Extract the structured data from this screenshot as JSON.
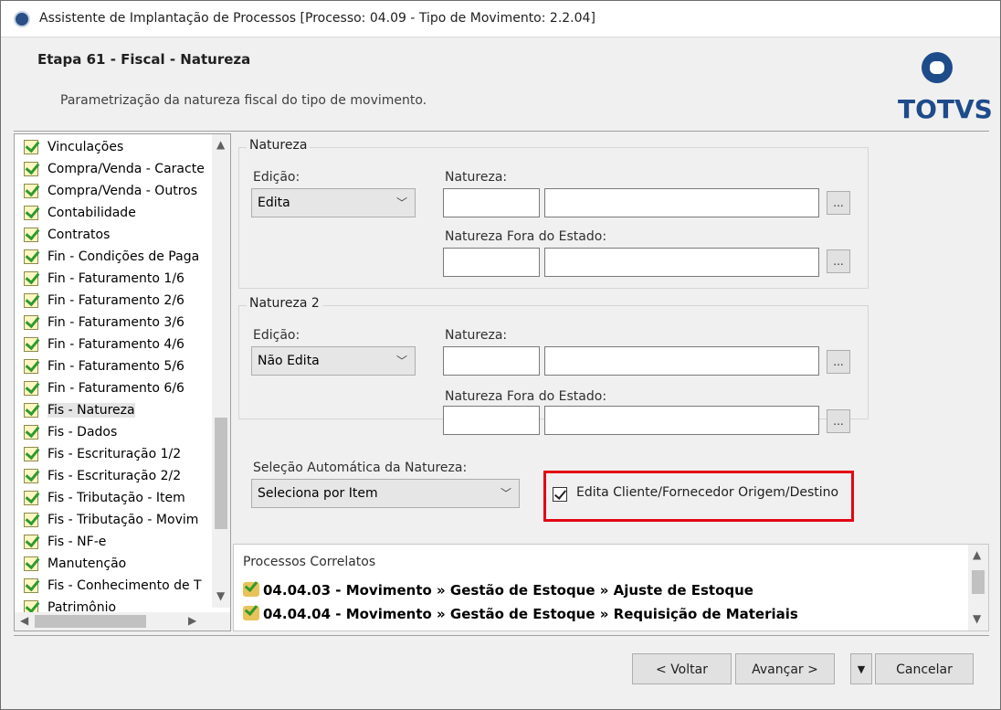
{
  "window": {
    "title": "Assistente de Implantação de Processos [Processo: 04.09 - Tipo de Movimento: 2.2.04]"
  },
  "header": {
    "step_title": "Etapa 61 - Fiscal - Natureza",
    "description": "Parametrização da natureza fiscal do tipo de movimento.",
    "logo_text": "TOTVS"
  },
  "tree": {
    "items": [
      {
        "label": "Vinculações"
      },
      {
        "label": "Compra/Venda - Caracte"
      },
      {
        "label": "Compra/Venda - Outros"
      },
      {
        "label": "Contabilidade"
      },
      {
        "label": "Contratos"
      },
      {
        "label": "Fin - Condições de Paga"
      },
      {
        "label": "Fin - Faturamento 1/6"
      },
      {
        "label": "Fin - Faturamento 2/6"
      },
      {
        "label": "Fin - Faturamento 3/6"
      },
      {
        "label": "Fin - Faturamento 4/6"
      },
      {
        "label": "Fin - Faturamento 5/6"
      },
      {
        "label": "Fin - Faturamento 6/6"
      },
      {
        "label": "Fis - Natureza",
        "selected": true
      },
      {
        "label": "Fis - Dados"
      },
      {
        "label": "Fis - Escrituração 1/2"
      },
      {
        "label": "Fis - Escrituração 2/2"
      },
      {
        "label": "Fis - Tributação - Item"
      },
      {
        "label": "Fis - Tributação - Movim"
      },
      {
        "label": "Fis - NF-e"
      },
      {
        "label": "Manutenção"
      },
      {
        "label": "Fis - Conhecimento de T"
      },
      {
        "label": "Patrimônio"
      }
    ]
  },
  "natureza": {
    "legend": "Natureza",
    "edicao_label": "Edição:",
    "edicao_value": "Edita",
    "natureza_label": "Natureza:",
    "fora_label": "Natureza Fora do Estado:",
    "dots": "..."
  },
  "natureza2": {
    "legend": "Natureza 2",
    "edicao_label": "Edição:",
    "edicao_value": "Não Edita",
    "natureza_label": "Natureza:",
    "fora_label": "Natureza Fora do Estado:",
    "dots": "..."
  },
  "selecao": {
    "label": "Seleção Automática da Natureza:",
    "value": "Seleciona por Item"
  },
  "checkbox": {
    "label": "Edita Cliente/Fornecedor Origem/Destino",
    "checked": true
  },
  "correlatos": {
    "title": "Processos Correlatos",
    "items": [
      "04.04.03 - Movimento » Gestão de Estoque » Ajuste de Estoque",
      "04.04.04 - Movimento » Gestão de Estoque » Requisição de Materiais"
    ]
  },
  "buttons": {
    "voltar": "< Voltar",
    "avancar": "Avançar >",
    "cancelar": "Cancelar"
  },
  "colors": {
    "highlight_border": "#e30613",
    "logo_blue": "#1e4b8a"
  }
}
